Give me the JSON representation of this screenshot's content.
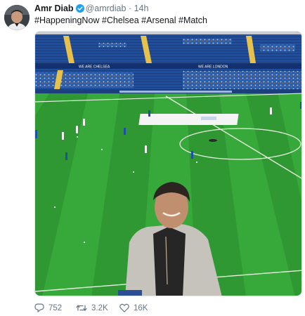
{
  "tweet": {
    "author_name": "Amr Diab",
    "handle": "@amrdiab",
    "separator": "·",
    "time": "14h",
    "text": "#HappeningNow #Chelsea #Arsenal #Match",
    "verified": true
  },
  "media": {
    "banner_left": "WE ARE CHELSEA",
    "banner_right": "WE ARE LONDON"
  },
  "actions": {
    "replies": "752",
    "retweets": "3.2K",
    "likes": "16K"
  },
  "colors": {
    "verified_badge": "#1da1f2",
    "muted_text": "#657786",
    "pitch_green": "#35a93a",
    "stand_blue": "#1e4c9a"
  },
  "icons": [
    "verified-badge-icon",
    "reply-icon",
    "retweet-icon",
    "like-icon"
  ]
}
